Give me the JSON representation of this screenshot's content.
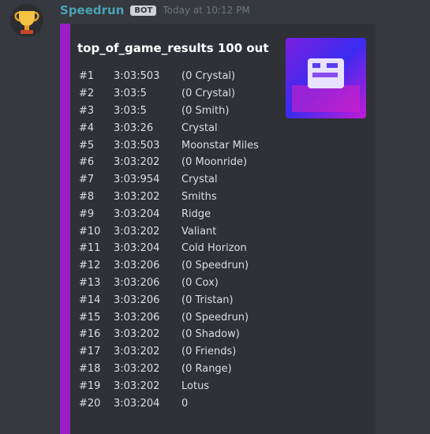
{
  "message": {
    "username": "Speedrun",
    "bot_tag": "BOT",
    "timestamp": "Today at 10:12 PM",
    "avatar_icon": "trophy-icon"
  },
  "embed": {
    "accent_color": "#9b1fc9",
    "title": "top_of_game_results 100 out",
    "thumbnail_icon": "game-cover-icon",
    "rows": [
      {
        "rank": "#1",
        "score": "3:03:503",
        "name": "(0 Crystal)"
      },
      {
        "rank": "#2",
        "score": "3:03:5",
        "name": "(0 Crystal)"
      },
      {
        "rank": "#3",
        "score": "3:03:5",
        "name": "(0 Smith)"
      },
      {
        "rank": "#4",
        "score": "3:03:26",
        "name": "Crystal"
      },
      {
        "rank": "#5",
        "score": "3:03:503",
        "name": "Moonstar Miles"
      },
      {
        "rank": "#6",
        "score": "3:03:202",
        "name": "(0 Moonride)"
      },
      {
        "rank": "#7",
        "score": "3:03:954",
        "name": "Crystal"
      },
      {
        "rank": "#8",
        "score": "3:03:202",
        "name": "Smiths"
      },
      {
        "rank": "#9",
        "score": "3:03:204",
        "name": "Ridge"
      },
      {
        "rank": "#10",
        "score": "3:03:202",
        "name": "Valiant"
      },
      {
        "rank": "#11",
        "score": "3:03:204",
        "name": "Cold Horizon"
      },
      {
        "rank": "#12",
        "score": "3:03:206",
        "name": "(0 Speedrun)"
      },
      {
        "rank": "#13",
        "score": "3:03:206",
        "name": "(0 Cox)"
      },
      {
        "rank": "#14",
        "score": "3:03:206",
        "name": "(0 Tristan)"
      },
      {
        "rank": "#15",
        "score": "3:03:206",
        "name": "(0 Speedrun)"
      },
      {
        "rank": "#16",
        "score": "3:03:202",
        "name": "(0 Shadow)"
      },
      {
        "rank": "#17",
        "score": "3:03:202",
        "name": "(0 Friends)"
      },
      {
        "rank": "#18",
        "score": "3:03:202",
        "name": "(0 Range)"
      },
      {
        "rank": "#19",
        "score": "3:03:202",
        "name": "Lotus"
      },
      {
        "rank": "#20",
        "score": "3:03:204",
        "name": "0"
      }
    ]
  }
}
